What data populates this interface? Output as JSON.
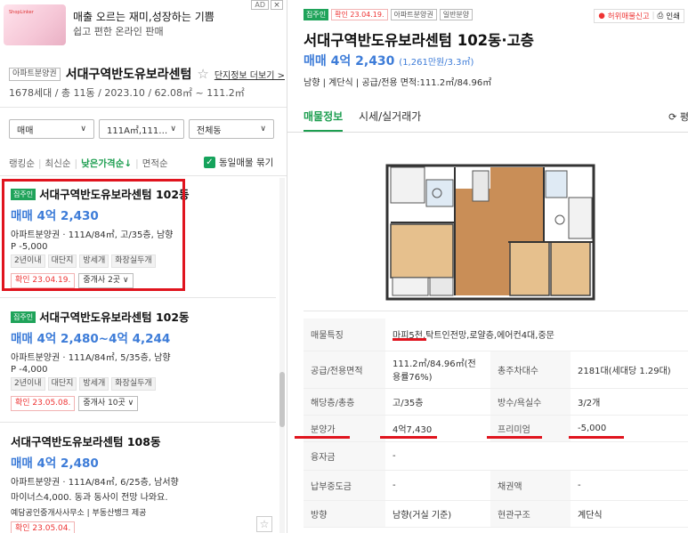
{
  "ad": {
    "brand": "ShopLinker",
    "title": "매출 오르는 재미,성장하는 기쁨",
    "subtitle": "쉽고 편한 온라인 판매",
    "badge": "AD",
    "close": "×"
  },
  "complex": {
    "type_tag": "아파트분양권",
    "name": "서대구역반도유보라센텀",
    "more_link": "단지정보 더보기 >",
    "meta": "1678세대 / 총 11동 / 2023.10 / 62.08㎡ ~ 111.2㎡"
  },
  "filters": {
    "trade_type": "매매",
    "area": "111A㎡,111…",
    "dong": "전체동"
  },
  "sort": {
    "options": [
      "랭킹순",
      "최신순",
      "낮은가격순↓",
      "면적순"
    ],
    "active_index": 2,
    "same_listing_label": "동일매물 묶기"
  },
  "listings": [
    {
      "badge": "집주인",
      "title": "서대구역반도유보라센텀 102동",
      "price": "매매 4억 2,430",
      "info": "아파트분양권 · 111A/84㎡, 고/35층, 남향",
      "extra": "P -5,000",
      "tags": [
        "2년이내",
        "대단지",
        "방세개",
        "화장실두개"
      ],
      "confirm": "확인 23.04.19.",
      "agents": "중개사 2곳 ∨"
    },
    {
      "badge": "집주인",
      "title": "서대구역반도유보라센텀 102동",
      "price": "매매 4억 2,480~4억 4,244",
      "info": "아파트분양권 · 111A/84㎡, 5/35층, 남향",
      "extra": "P -4,000",
      "tags": [
        "2년이내",
        "대단지",
        "방세개",
        "화장실두개"
      ],
      "confirm": "확인 23.05.08.",
      "agents": "중개사 10곳 ∨"
    },
    {
      "title": "서대구역반도유보라센텀 108동",
      "price": "매매 4억 2,480",
      "info": "아파트분양권 · 111A/84㎡, 6/25층, 남서향",
      "extra": "마이너스4,000. 동과 동사이 전망 나와요.",
      "agent_line": "예담공인중개사사무소 | 부동산뱅크 제공",
      "confirm": "확인 23.05.04."
    }
  ],
  "detail": {
    "tags": [
      "집주인",
      "확인 23.04.19.",
      "아파트분양권",
      "일반분양"
    ],
    "report": "허위매물신고",
    "print": "인쇄",
    "title": "서대구역반도유보라센텀 102동·고층",
    "price": "매매 4억 2,430",
    "price_unit": "(1,261만원/3.3㎡)",
    "sub": "남향 | 계단식 | 공급/전용 면적:111.2㎡/84.96㎡",
    "tabs": [
      "매물정보",
      "시세/실거래가",
      "⟳ 평"
    ],
    "table": [
      {
        "l1": "매물특징",
        "v1": "마피5천,탁트인전망,로얄층,에어컨4대,중문",
        "l2": "",
        "v2": ""
      },
      {
        "l1": "공급/전용면적",
        "v1": "111.2㎡/84.96㎡(전용률76%)",
        "l2": "총주차대수",
        "v2": "2181대(세대당 1.29대)"
      },
      {
        "l1": "해당층/총층",
        "v1": "고/35층",
        "l2": "방수/욕실수",
        "v2": "3/2개"
      },
      {
        "l1": "분양가",
        "v1": "4억7,430",
        "l2": "프리미엄",
        "v2": "-5,000"
      },
      {
        "l1": "융자금",
        "v1": "-",
        "l2": "",
        "v2": ""
      },
      {
        "l1": "납부중도금",
        "v1": "-",
        "l2": "채권액",
        "v2": "-"
      },
      {
        "l1": "방향",
        "v1": "남향(거실 기준)",
        "l2": "현관구조",
        "v2": "계단식"
      }
    ]
  },
  "colors": {
    "accent_green": "#1d9e50",
    "price_blue": "#3d7cd8",
    "highlight_red": "#e0141e"
  }
}
